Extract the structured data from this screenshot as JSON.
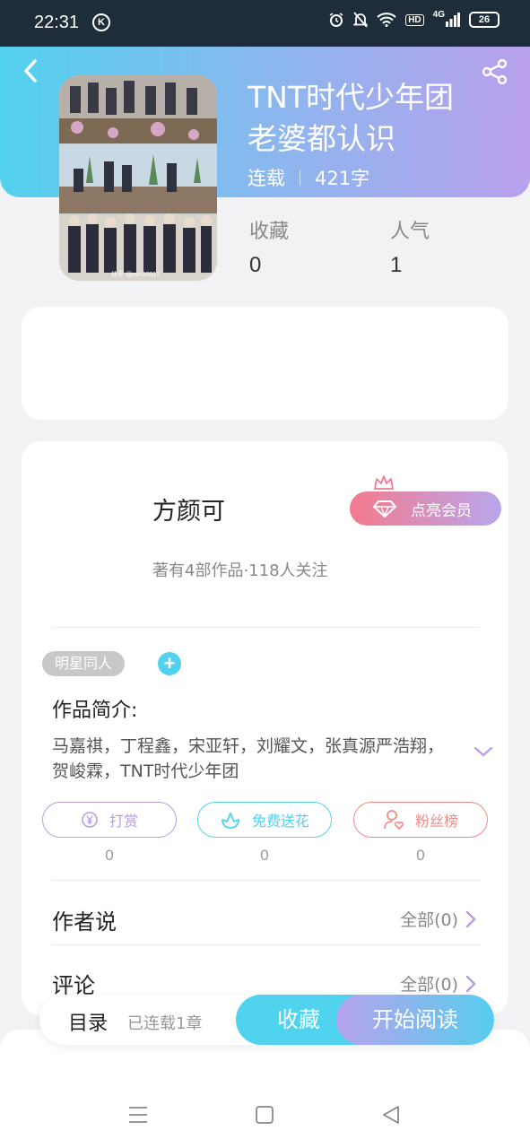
{
  "status_bar": {
    "time": "22:31",
    "k_badge": "K",
    "network": "4G",
    "hd_badge": "HD",
    "battery": "26"
  },
  "header": {
    "back_icon": "chevron-left-icon",
    "share_icon": "share-icon",
    "gradient_start": "#52d1ee",
    "gradient_end": "#b9a0ec"
  },
  "book": {
    "title_line1": "TNT时代少年团",
    "title_line2": "老婆都认识",
    "status": "连载",
    "word_count": "421字",
    "cover_caption": "快手 @mm30917"
  },
  "stats": {
    "favorites_label": "收藏",
    "favorites_value": "0",
    "popularity_label": "人气",
    "popularity_value": "1"
  },
  "author": {
    "name": "方颜可",
    "stats": "著有4部作品·118人关注",
    "vip_button": "点亮会员",
    "vip_icon": "diamond-icon",
    "crown_icon": "crown-icon"
  },
  "tags": {
    "tag1": "明星同人",
    "add_icon": "plus-icon"
  },
  "intro": {
    "title": "作品简介:",
    "text": "马嘉祺，丁程鑫，宋亚轩，刘耀文，张真源严浩翔，贺峻霖，TNT时代少年团",
    "expand_icon": "chevron-down-icon"
  },
  "actions": {
    "tip_label": "打赏",
    "tip_icon": "yuan-coin-icon",
    "tip_count": "0",
    "flower_label": "免费送花",
    "flower_icon": "flower-icon",
    "flower_count": "0",
    "fans_label": "粉丝榜",
    "fans_icon": "user-heart-icon",
    "fans_count": "0",
    "tip_color": "#b99be6",
    "flower_color": "#4fd1ef",
    "fans_color": "#ef8a86"
  },
  "author_says": {
    "title": "作者说",
    "link": "全部(0)"
  },
  "comments": {
    "title": "评论",
    "link": "全部(0)"
  },
  "bottom_bar": {
    "toc_label": "目录",
    "toc_status": "已连载1章",
    "collect_button": "收藏",
    "read_button": "开始阅读"
  },
  "nav_bar": {
    "menu_icon": "menu-icon",
    "home_icon": "square-icon",
    "back_icon": "triangle-back-icon"
  }
}
